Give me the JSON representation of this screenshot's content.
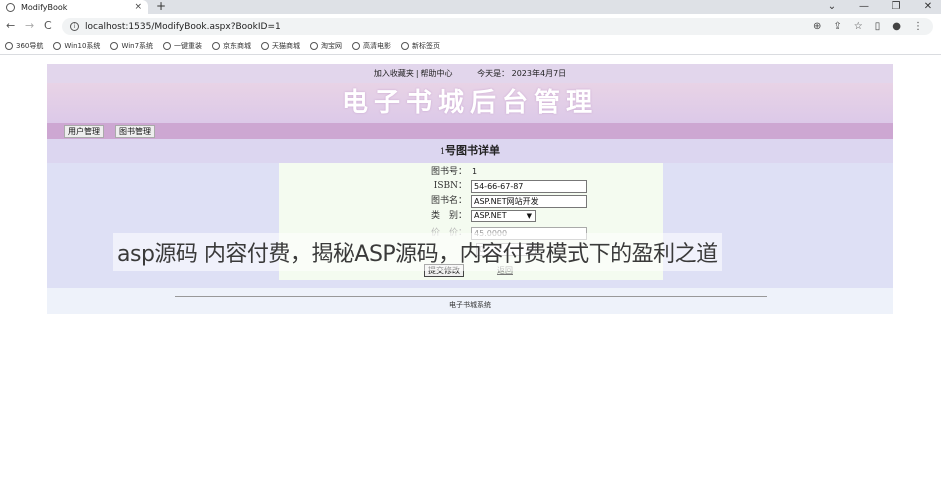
{
  "browser": {
    "tab_title": "ModifyBook",
    "tab_close": "×",
    "new_tab": "+",
    "window_controls": [
      "⌄",
      "—",
      "❐",
      "✕"
    ],
    "nav": {
      "back": "←",
      "forward": "→",
      "reload": "C"
    },
    "url": "localhost:1535/ModifyBook.aspx?BookID=1",
    "omnibox_icons": [
      "zoom-icon",
      "share-icon",
      "star-icon",
      "sidepanel-icon",
      "profile-icon",
      "menu-icon"
    ],
    "bookmarks": [
      "360导航",
      "Win10系统",
      "Win7系统",
      "一键重装",
      "京东商城",
      "天猫商城",
      "淘宝网",
      "高清电影",
      "新标签页"
    ]
  },
  "page": {
    "top_links": {
      "add_favorite": "加入收藏夹",
      "separator": "|",
      "help": "帮助中心",
      "today_label": "今天是：",
      "date": "2023年4月7日"
    },
    "banner_title": "电子书城后台管理",
    "menu": [
      "用户管理",
      "图书管理"
    ],
    "detail_header": {
      "book_id": "1",
      "title": "号图书详单"
    },
    "form": {
      "book_no_label": "图书号：",
      "book_no_value": "1",
      "isbn_label": "ISBN：",
      "isbn_value": "54-66-67-87",
      "name_label": "图书名：",
      "name_value": "ASP.NET网站开发",
      "category_label": "类　别：",
      "category_value": "ASP.NET",
      "price_label": "价　价：",
      "price_value": "45.0000",
      "qty_value": "0",
      "submit": "提交修改",
      "back": "返回"
    },
    "footer": "电子书城系统"
  },
  "overlay": {
    "caption": "asp源码 内容付费，揭秘ASP源码，内容付费模式下的盈利之道"
  }
}
